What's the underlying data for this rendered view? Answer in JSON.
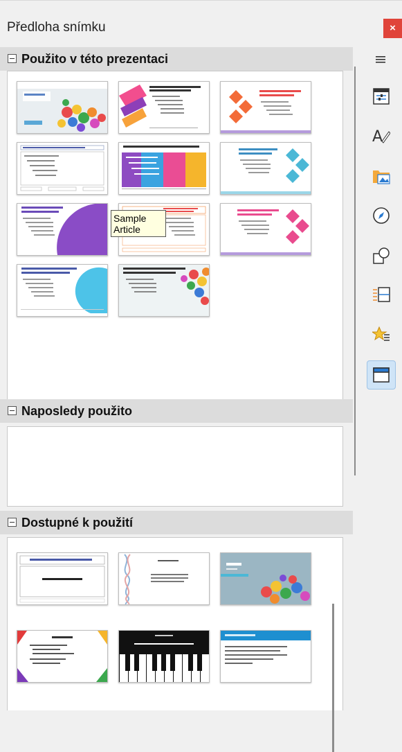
{
  "panel": {
    "title": "Předloha snímku",
    "close_label": "×"
  },
  "sections": {
    "used": {
      "label": "Použito v této prezentaci"
    },
    "recent": {
      "label": "Naposledy použito"
    },
    "available": {
      "label": "Dostupné k použití"
    }
  },
  "used_thumbs": [
    {
      "design": "candy-photo"
    },
    {
      "design": "pink-stripes"
    },
    {
      "design": "orange-diamonds"
    },
    {
      "design": "outline-plain"
    },
    {
      "design": "color-columns"
    },
    {
      "design": "teal-diamonds"
    },
    {
      "design": "purple-circle"
    },
    {
      "design": "outline-orange"
    },
    {
      "design": "pink-diamonds"
    },
    {
      "design": "cyan-circle"
    },
    {
      "design": "candy-corner"
    }
  ],
  "tooltip": "Sample Article",
  "available_thumbs": [
    {
      "design": "plain-title"
    },
    {
      "design": "dna-left"
    },
    {
      "design": "candy-lorem"
    },
    {
      "design": "colored-corners"
    },
    {
      "design": "piano"
    },
    {
      "design": "blue-header"
    }
  ],
  "sidebar_tabs": [
    {
      "name": "menu-icon"
    },
    {
      "name": "properties-icon"
    },
    {
      "name": "styles-icon"
    },
    {
      "name": "gallery-icon"
    },
    {
      "name": "navigator-icon"
    },
    {
      "name": "shapes-icon"
    },
    {
      "name": "slide-transition-icon"
    },
    {
      "name": "animation-icon"
    },
    {
      "name": "master-slides-icon"
    }
  ],
  "colors": {
    "accent": "#cfe4f7",
    "close": "#e0443a",
    "section_header": "#dcdcdc"
  }
}
